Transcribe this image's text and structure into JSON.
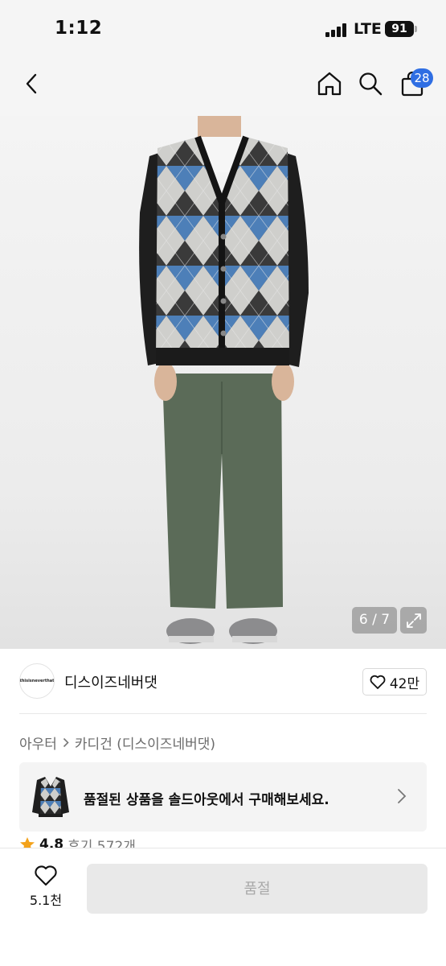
{
  "status_bar": {
    "time": "1:12",
    "network": "LTE",
    "battery": "91"
  },
  "nav": {
    "cart_count": "28"
  },
  "gallery": {
    "counter": "6 / 7"
  },
  "brand": {
    "logo_text": "thisisneverthat",
    "name": "디스이즈네버댓",
    "likes": "42만"
  },
  "breadcrumb": {
    "category": "아우터",
    "subcategory": "카디건 (디스이즈네버댓)"
  },
  "soldout_banner": {
    "text": "품절된 상품을 솔드아웃에서 구매해보세요."
  },
  "rating": {
    "value": "4.8",
    "reviews": "후기 572개"
  },
  "bottom": {
    "wish_count": "5.1천",
    "buy_label": "품절"
  },
  "colors": {
    "accent": "#2f6ee3",
    "disabled_button": "#e9e9e9",
    "banner_bg": "#f4f4f4"
  }
}
